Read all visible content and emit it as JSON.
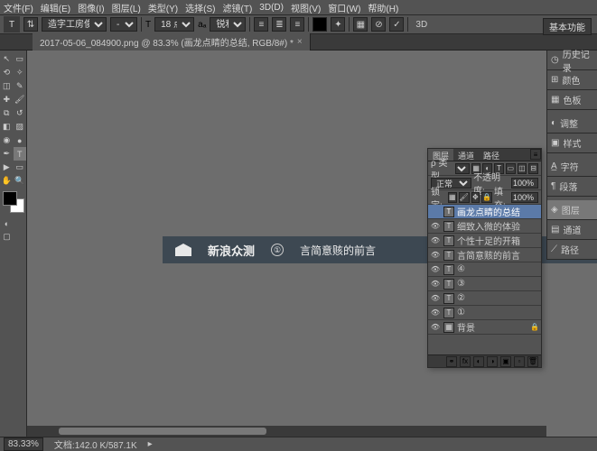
{
  "menu": {
    "file": "文件(F)",
    "edit": "编辑(E)",
    "image": "图像(I)",
    "layer": "图层(L)",
    "type": "类型(Y)",
    "select": "选择(S)",
    "filter": "滤镜(T)",
    "d3": "3D(D)",
    "view": "视图(V)",
    "window": "窗口(W)",
    "help": "帮助(H)"
  },
  "options": {
    "tool": "T",
    "font_family": "造字工房俊...",
    "weight": "T",
    "size_icon": "T",
    "size": "18 点",
    "aa": "锐利",
    "3d": "3D"
  },
  "workspace_switcher": "基本功能",
  "tab": {
    "title": "2017-05-06_084900.png @ 83.3% (画龙点睛的总结, RGB/8#) *",
    "close": "×"
  },
  "banner": {
    "brand": "新浪众测",
    "num": "①",
    "text": "言简意赅的前言"
  },
  "dock": {
    "history": "历史记录",
    "color": "颜色",
    "swatches": "色板",
    "adjust": "调整",
    "styles": "样式",
    "char": "字符",
    "para": "段落",
    "layers": "图层",
    "channels": "通道",
    "paths": "路径"
  },
  "layers_panel": {
    "tabs": {
      "layers": "图层",
      "channels": "通道",
      "paths": "路径"
    },
    "kind_label": "ρ 类型",
    "kind_value": "",
    "blend": "正常",
    "opacity_label": "不透明度:",
    "opacity": "100%",
    "lock_label": "锁定:",
    "fill_label": "填充:",
    "fill": "100%",
    "layers": [
      {
        "vis": "",
        "icon": "T",
        "name": "画龙点睛的总结",
        "selected": true,
        "lock": ""
      },
      {
        "vis": "👁",
        "icon": "T",
        "name": "细致入微的体验",
        "selected": false,
        "lock": ""
      },
      {
        "vis": "👁",
        "icon": "T",
        "name": "个性十足的开箱",
        "selected": false,
        "lock": ""
      },
      {
        "vis": "👁",
        "icon": "T",
        "name": "言简意赅的前言",
        "selected": false,
        "lock": ""
      },
      {
        "vis": "👁",
        "icon": "T",
        "name": "④",
        "selected": false,
        "lock": ""
      },
      {
        "vis": "👁",
        "icon": "T",
        "name": "③",
        "selected": false,
        "lock": ""
      },
      {
        "vis": "👁",
        "icon": "T",
        "name": "②",
        "selected": false,
        "lock": ""
      },
      {
        "vis": "👁",
        "icon": "T",
        "name": "①",
        "selected": false,
        "lock": ""
      },
      {
        "vis": "👁",
        "icon": "▦",
        "name": "背景",
        "selected": false,
        "lock": "🔒"
      }
    ]
  },
  "status": {
    "zoom": "83.33%",
    "doc": "文档:142.0 K/587.1K"
  }
}
